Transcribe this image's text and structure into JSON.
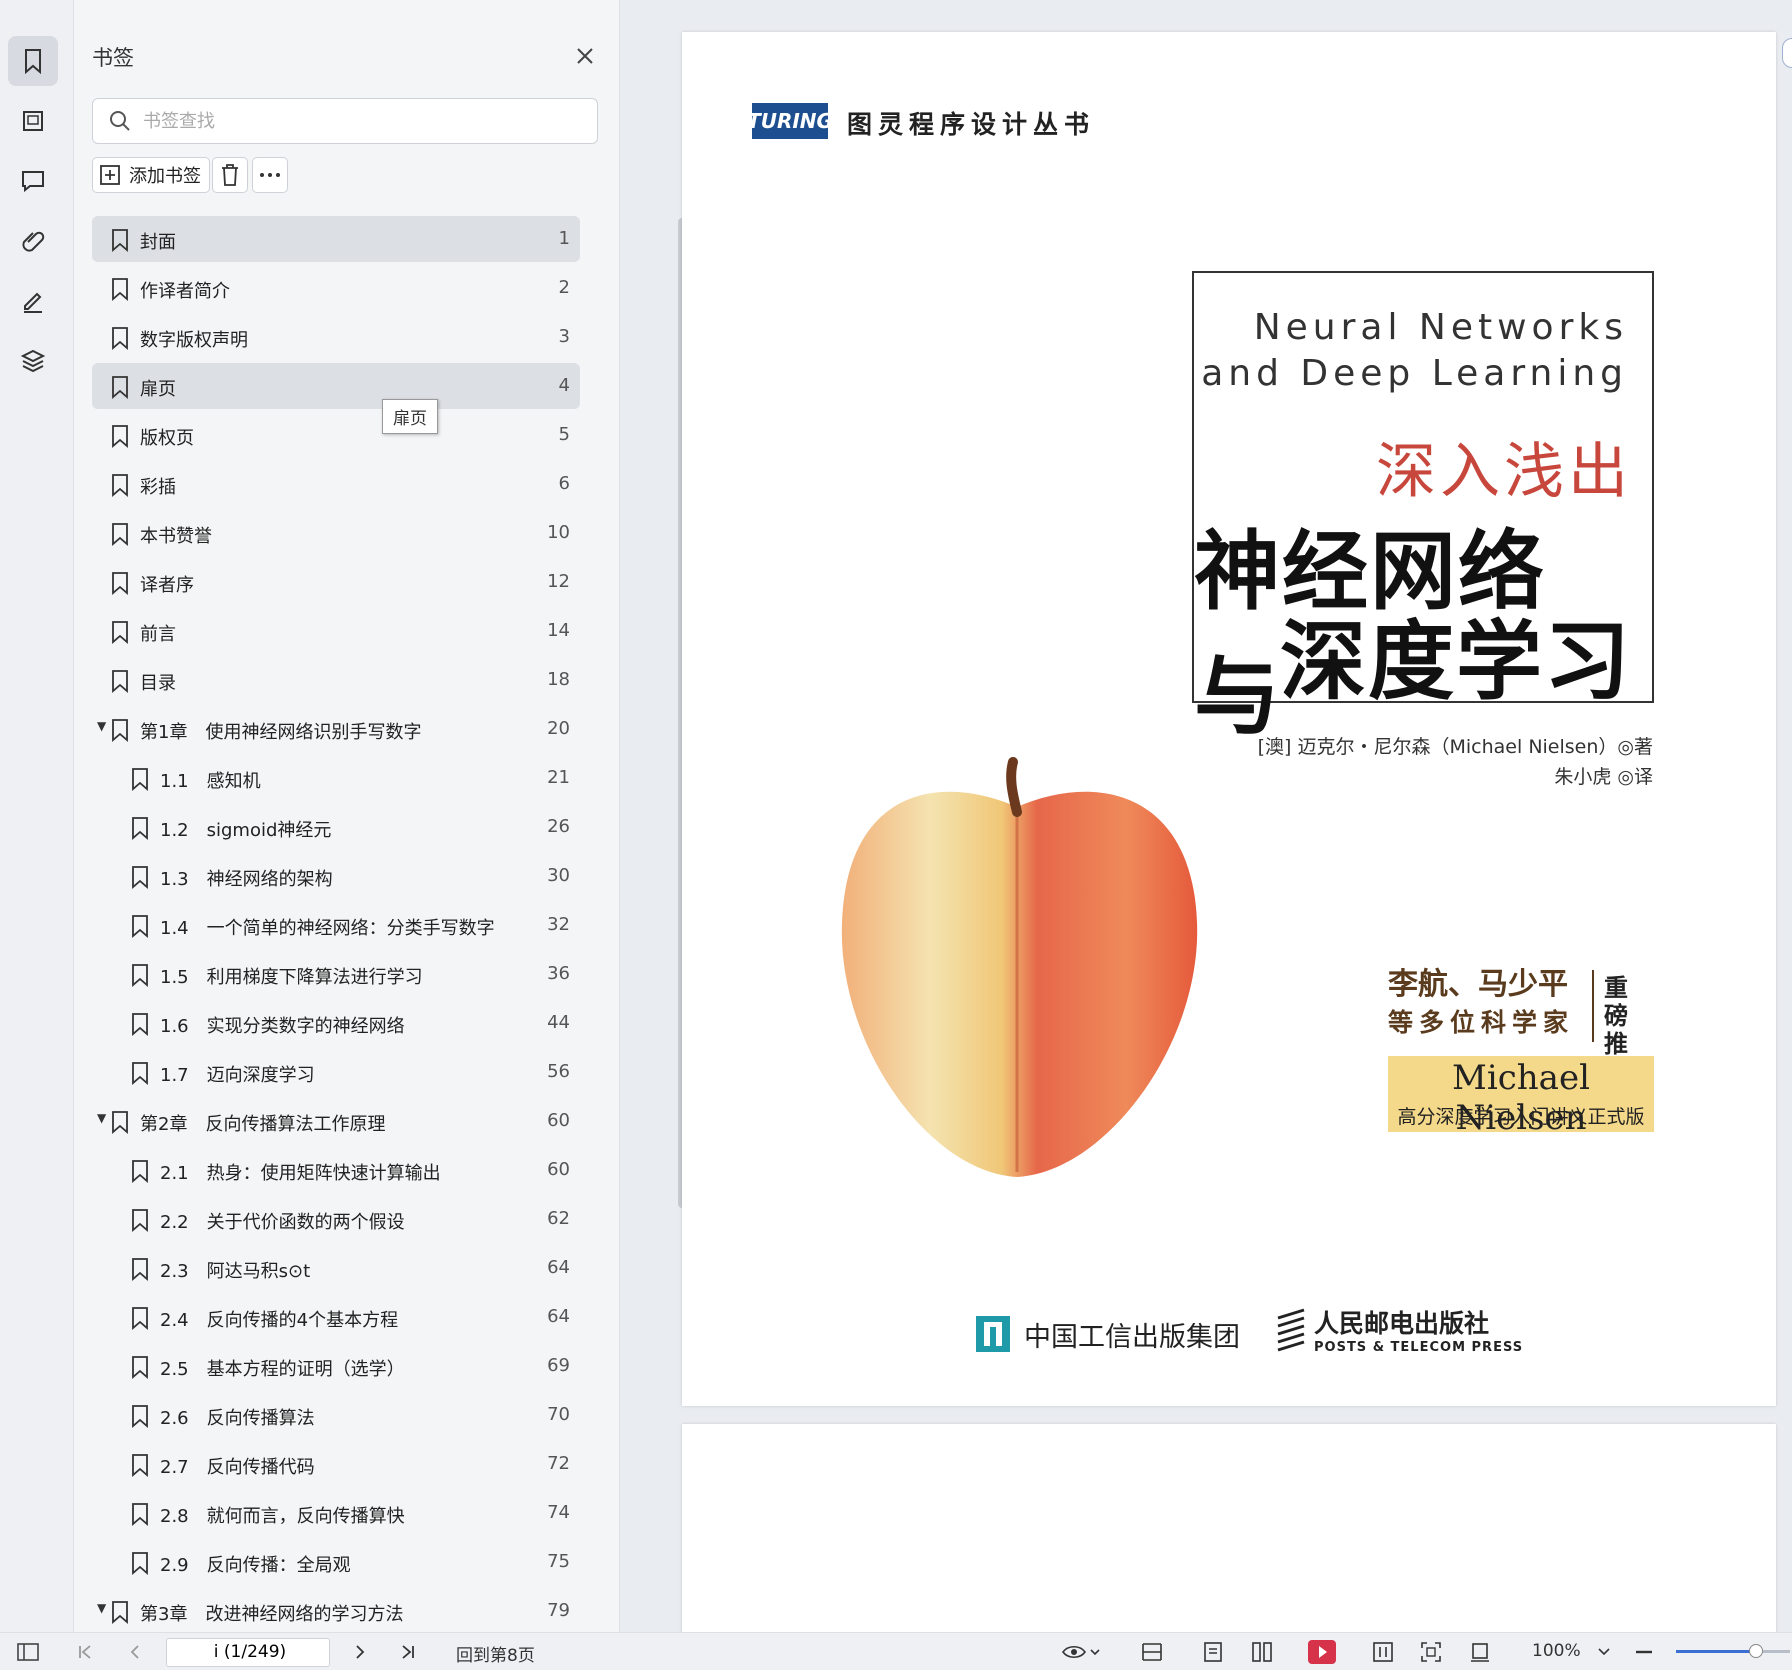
{
  "sidebar_rail": {
    "icons": [
      "bookmark-icon",
      "thumbnail-icon",
      "comment-icon",
      "attachment-icon",
      "signature-icon",
      "layers-icon"
    ]
  },
  "bookmark_panel": {
    "title": "书签",
    "search_placeholder": "书签查找",
    "add_label": "添加书签",
    "tooltip": "扉页",
    "items": [
      {
        "label": "封面",
        "page": "1",
        "level": 0,
        "selected": true
      },
      {
        "label": "作译者简介",
        "page": "2",
        "level": 0
      },
      {
        "label": "数字版权声明",
        "page": "3",
        "level": 0
      },
      {
        "label": "扉页",
        "page": "4",
        "level": 0,
        "hover": true
      },
      {
        "label": "版权页",
        "page": "5",
        "level": 0
      },
      {
        "label": "彩插",
        "page": "6",
        "level": 0
      },
      {
        "label": "本书赞誉",
        "page": "10",
        "level": 0
      },
      {
        "label": "译者序",
        "page": "12",
        "level": 0
      },
      {
        "label": "前言",
        "page": "14",
        "level": 0
      },
      {
        "label": "目录",
        "page": "18",
        "level": 0
      },
      {
        "label": "第1章　使用神经网络识别手写数字",
        "page": "20",
        "level": 0,
        "expanded": true
      },
      {
        "label": "1.1　感知机",
        "page": "21",
        "level": 1
      },
      {
        "label": "1.2　sigmoid神经元",
        "page": "26",
        "level": 1
      },
      {
        "label": "1.3　神经网络的架构",
        "page": "30",
        "level": 1
      },
      {
        "label": "1.4　一个简单的神经网络：分类手写数字",
        "page": "32",
        "level": 1
      },
      {
        "label": "1.5　利用梯度下降算法进行学习",
        "page": "36",
        "level": 1
      },
      {
        "label": "1.6　实现分类数字的神经网络",
        "page": "44",
        "level": 1
      },
      {
        "label": "1.7　迈向深度学习",
        "page": "56",
        "level": 1
      },
      {
        "label": "第2章　反向传播算法工作原理",
        "page": "60",
        "level": 0,
        "expanded": true
      },
      {
        "label": "2.1　热身：使用矩阵快速计算输出",
        "page": "60",
        "level": 1
      },
      {
        "label": "2.2　关于代价函数的两个假设",
        "page": "62",
        "level": 1
      },
      {
        "label": "2.3　阿达马积s⊙t",
        "page": "64",
        "level": 1
      },
      {
        "label": "2.4　反向传播的4个基本方程",
        "page": "64",
        "level": 1
      },
      {
        "label": "2.5　基本方程的证明（选学）",
        "page": "69",
        "level": 1
      },
      {
        "label": "2.6　反向传播算法",
        "page": "70",
        "level": 1
      },
      {
        "label": "2.7　反向传播代码",
        "page": "72",
        "level": 1
      },
      {
        "label": "2.8　就何而言，反向传播算快",
        "page": "74",
        "level": 1
      },
      {
        "label": "2.9　反向传播：全局观",
        "page": "75",
        "level": 1
      },
      {
        "label": "第3章　改进神经网络的学习方法",
        "page": "79",
        "level": 0,
        "expanded": true
      }
    ]
  },
  "cover": {
    "logo": "TURING",
    "series": "图灵程序设计丛书",
    "title_en_1": "Neural Networks",
    "title_en_2": "and Deep Learning",
    "title_cn_red": "深入浅出",
    "title_cn_1": "神经网络与",
    "title_cn_2": "深度学习",
    "author_line": "[澳] 迈克尔・尼尔森（Michael Nielsen）◎著",
    "translator_line": "朱小虎 ◎译",
    "reco_names_1": "李航、马少平",
    "reco_names_2": "等多位科学家",
    "reco_tag_1": "重磅",
    "reco_tag_2": "推荐",
    "badge_name": "Michael Nielsen",
    "badge_sub": "高分深度学习入门讲义正式版",
    "publisher_1": "中国工信出版集团",
    "publisher_2_cn": "人民邮电出版社",
    "publisher_2_en": "POSTS & TELECOM PRESS"
  },
  "statusbar": {
    "page_value": "i (1/249)",
    "go_back": "回到第8页",
    "zoom": "100%",
    "zoom_level_fraction": 0.8
  }
}
